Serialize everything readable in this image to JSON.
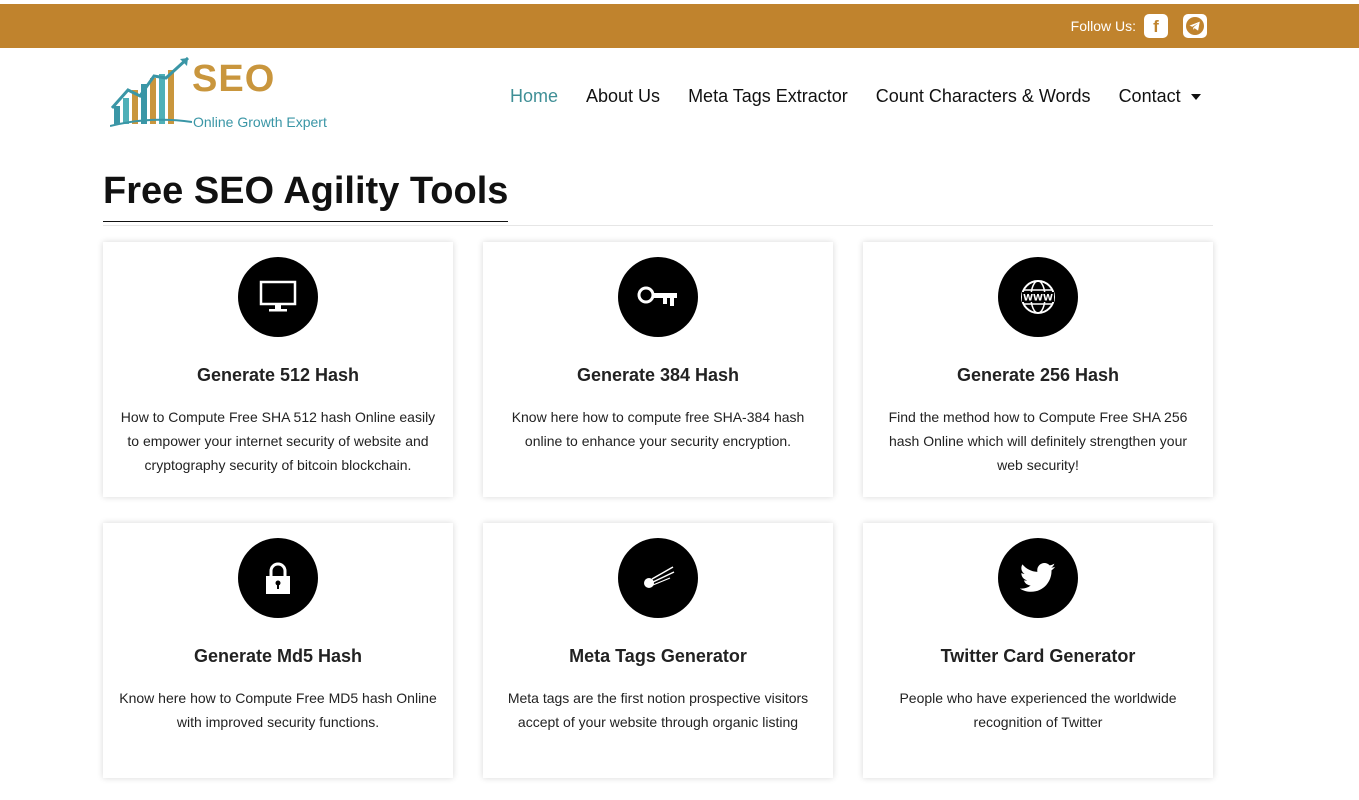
{
  "topbar": {
    "follow_label": "Follow Us:",
    "social": [
      {
        "icon": "facebook-icon"
      },
      {
        "icon": "telegram-icon"
      }
    ]
  },
  "brand": {
    "name": "SEO",
    "tagline": "Online Growth Expert"
  },
  "nav": {
    "items": [
      {
        "label": "Home",
        "active": true
      },
      {
        "label": "About Us"
      },
      {
        "label": "Meta Tags Extractor"
      },
      {
        "label": "Count Characters & Words"
      },
      {
        "label": "Contact",
        "dropdown": true
      }
    ]
  },
  "page": {
    "title": "Free SEO Agility Tools"
  },
  "cards": [
    {
      "icon": "monitor-icon",
      "title": "Generate 512 Hash",
      "desc": "How to Compute Free SHA 512 hash Online easily to empower your internet security of website and cryptography security of bitcoin blockchain."
    },
    {
      "icon": "key-icon",
      "title": "Generate 384 Hash",
      "desc": "Know here how to compute free SHA-384 hash online to enhance your security encryption."
    },
    {
      "icon": "globe-www-icon",
      "title": "Generate 256 Hash",
      "desc": "Find the method how to Compute Free SHA 256 hash Online which will definitely strengthen your web security!"
    },
    {
      "icon": "lock-icon",
      "title": "Generate Md5 Hash",
      "desc": "Know here how to Compute Free MD5 hash Online with improved security functions."
    },
    {
      "icon": "comet-icon",
      "title": "Meta Tags Generator",
      "desc": "Meta tags are the first notion prospective visitors accept of your website through organic listing"
    },
    {
      "icon": "twitter-bird-icon",
      "title": "Twitter Card Generator",
      "desc": "People who have experienced the worldwide recognition of Twitter"
    }
  ],
  "colors": {
    "topbar": "#c0832d",
    "nav_active": "#3f8f96",
    "brand_gold": "#c9963d",
    "brand_teal": "#3a96a6"
  }
}
